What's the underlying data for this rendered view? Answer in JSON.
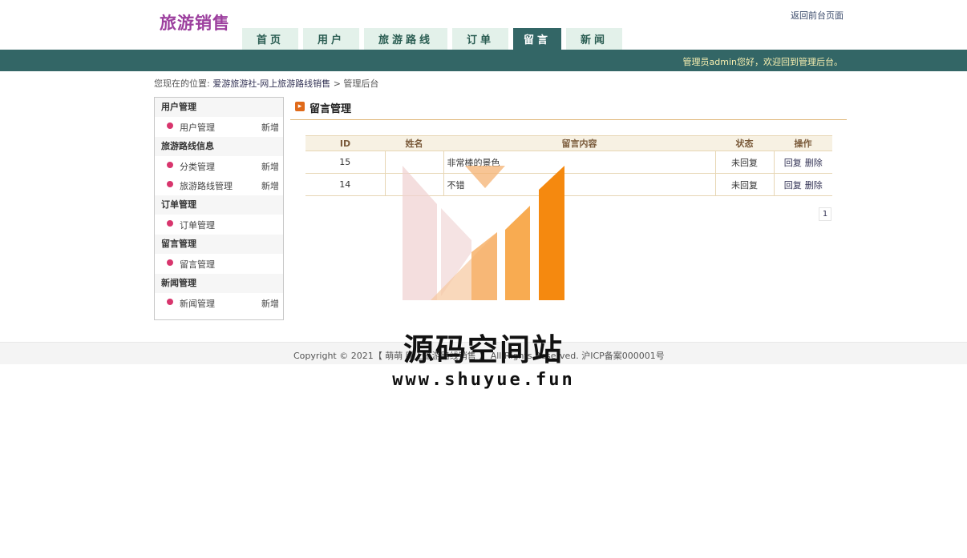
{
  "header": {
    "logo": "旅游销售",
    "back_link": "返回前台页面",
    "welcome": "管理员admin您好，欢迎回到管理后台。"
  },
  "nav": {
    "tabs": [
      {
        "label": "首页",
        "active": false
      },
      {
        "label": "用户",
        "active": false
      },
      {
        "label": "旅游路线",
        "active": false
      },
      {
        "label": "订单",
        "active": false
      },
      {
        "label": "留言",
        "active": true
      },
      {
        "label": "新闻",
        "active": false
      }
    ]
  },
  "breadcrumb": {
    "prefix": "您现在的位置:",
    "site": "爱游旅游社-网上旅游路线销售",
    "sep": ">",
    "current": "管理后台"
  },
  "sidebar": {
    "add_label": "新增",
    "groups": [
      {
        "title": "用户管理",
        "items": [
          {
            "label": "用户管理",
            "add": true
          }
        ]
      },
      {
        "title": "旅游路线信息",
        "items": [
          {
            "label": "分类管理",
            "add": true
          },
          {
            "label": "旅游路线管理",
            "add": true
          }
        ]
      },
      {
        "title": "订单管理",
        "items": [
          {
            "label": "订单管理",
            "add": false
          }
        ]
      },
      {
        "title": "留言管理",
        "items": [
          {
            "label": "留言管理",
            "add": false
          }
        ]
      },
      {
        "title": "新闻管理",
        "items": [
          {
            "label": "新闻管理",
            "add": true
          }
        ]
      }
    ]
  },
  "main": {
    "title": "留言管理",
    "table": {
      "headers": [
        "ID",
        "姓名",
        "留言内容",
        "状态",
        "操作"
      ],
      "rows": [
        {
          "id": "15",
          "name": "",
          "content": "非常棒的景色",
          "status": "未回复"
        },
        {
          "id": "14",
          "name": "",
          "content": "不错",
          "status": "未回复"
        }
      ],
      "actions": {
        "reply": "回复",
        "delete": "删除"
      }
    },
    "pager": {
      "current": "1"
    }
  },
  "footer": {
    "copyright": "Copyright © 2021【 萌萌 网上旅游路线销售 】 All Rights Reserved. 沪ICP备案000001号"
  },
  "watermark": {
    "title": "源码空间站",
    "url": "www.shuyue.fun"
  },
  "colors": {
    "brand_dark": "#336666",
    "nav_tab_bg": "#e3f1ea",
    "logo": "#9c3f9e",
    "accent_orange": "#f5890f",
    "bullet": "#d8356d"
  }
}
